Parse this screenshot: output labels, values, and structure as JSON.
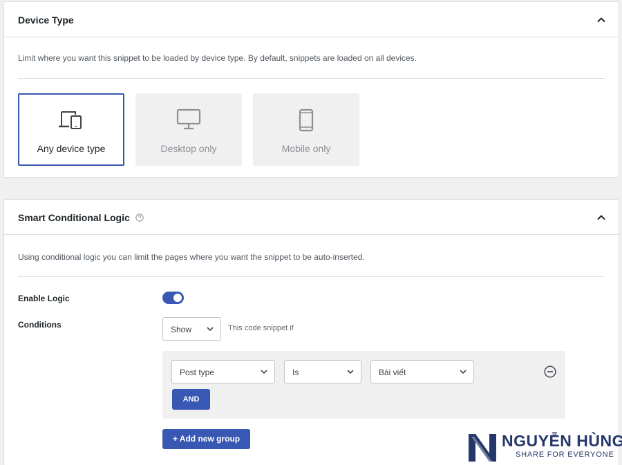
{
  "device_type": {
    "title": "Device Type",
    "description": "Limit where you want this snippet to be loaded by device type. By default, snippets are loaded on all devices.",
    "options": [
      {
        "label": "Any device type",
        "icon": "devices-icon",
        "selected": true
      },
      {
        "label": "Desktop only",
        "icon": "desktop-icon",
        "selected": false
      },
      {
        "label": "Mobile only",
        "icon": "mobile-icon",
        "selected": false
      }
    ]
  },
  "conditional_logic": {
    "title": "Smart Conditional Logic",
    "description": "Using conditional logic you can limit the pages where you want the snippet to be auto-inserted.",
    "enable_label": "Enable Logic",
    "enabled": true,
    "conditions_label": "Conditions",
    "show_select": "Show",
    "show_suffix": "This code snippet if",
    "rule": {
      "field": "Post type",
      "operator": "Is",
      "value": "Bài viết"
    },
    "and_button": "AND",
    "add_group_button": "+ Add new group"
  },
  "watermark": {
    "name": "NGUYỄN HÙNG",
    "tagline": "SHARE FOR EVERYONE"
  },
  "colors": {
    "accent": "#3858b3",
    "watermark": "#26376b"
  }
}
